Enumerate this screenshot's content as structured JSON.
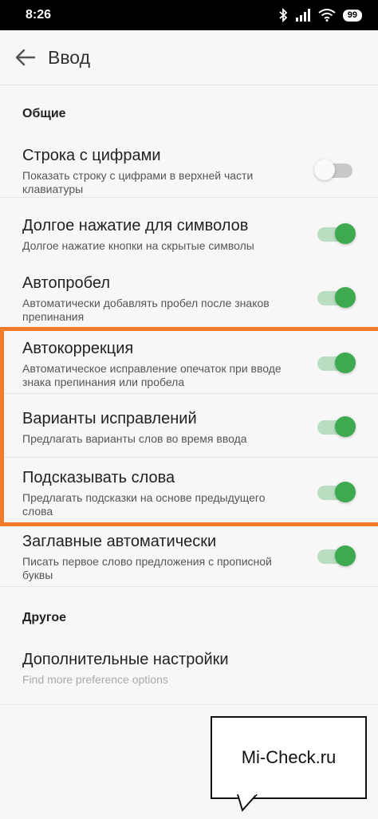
{
  "status": {
    "time": "8:26",
    "battery": "99",
    "icons": [
      "bluetooth-icon",
      "signal-icon",
      "wifi-icon",
      "battery-icon"
    ]
  },
  "header": {
    "title": "Ввод",
    "back_icon": "arrow-left-icon"
  },
  "sections": {
    "general": "Общие",
    "other": "Другое"
  },
  "settings": [
    {
      "title": "Строка с цифрами",
      "subtitle": "Показать строку с цифрами в верхней части клавиатуры",
      "enabled": false
    },
    {
      "title": "Долгое нажатие для символов",
      "subtitle": "Долгое нажатие кнопки на скрытые символы",
      "enabled": true
    },
    {
      "title": "Автопробел",
      "subtitle": "Автоматически добавлять пробел после знаков препинания",
      "enabled": true
    },
    {
      "title": "Автокоррекция",
      "subtitle": "Автоматическое исправление опечаток при вводе знака препинания или пробела",
      "enabled": true
    },
    {
      "title": "Варианты исправлений",
      "subtitle": "Предлагать варианты слов во время ввода",
      "enabled": true
    },
    {
      "title": "Подсказывать слова",
      "subtitle": "Предлагать подсказки на основе предыдущего слова",
      "enabled": true
    },
    {
      "title": "Заглавные автоматически",
      "subtitle": "Писать первое слово предложения с прописной буквы",
      "enabled": true
    }
  ],
  "more": {
    "title": "Дополнительные настройки",
    "subtitle": "Find more preference options"
  },
  "watermark": {
    "text": "Mi-Check.ru"
  },
  "colors": {
    "toggle_on": "#3daa4f",
    "highlight": "#f47b2a"
  }
}
